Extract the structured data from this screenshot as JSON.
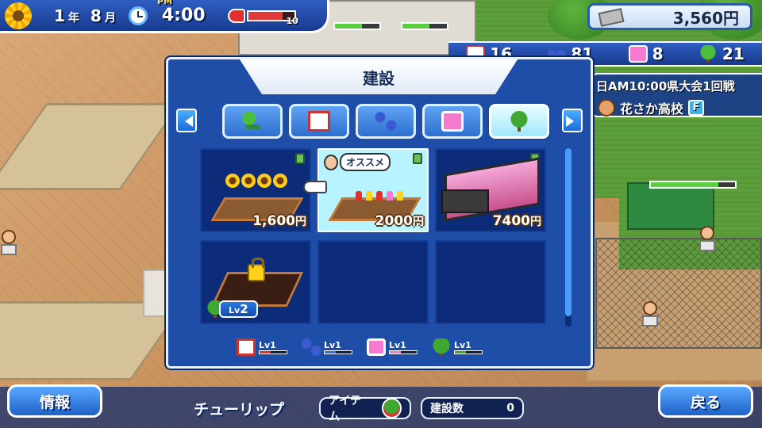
{
  "hud": {
    "year": "1",
    "year_unit": "年",
    "month": "8",
    "month_unit": "月",
    "ampm": "PM",
    "time": "4:00",
    "stamina_value": "10",
    "stamina_level": 0.75,
    "money": "3,560円",
    "stats": [
      {
        "icon": "book-icon",
        "value": "16"
      },
      {
        "icon": "dumbbell-icon",
        "value": "81"
      },
      {
        "icon": "music-note-icon",
        "value": "8"
      },
      {
        "icon": "tree-icon",
        "value": "21"
      }
    ],
    "event": "日AM10:00県大会1回戦",
    "school": "花さか高校",
    "rank": "F"
  },
  "dialog": {
    "title": "建設",
    "tabs": [
      {
        "icon": "bench-tree-icon",
        "active": false
      },
      {
        "icon": "book-icon",
        "active": false
      },
      {
        "icon": "dumbbell-icon",
        "active": false
      },
      {
        "icon": "music-note-icon",
        "active": false
      },
      {
        "icon": "tree-icon",
        "active": true
      }
    ],
    "items": [
      {
        "name": "sunflower-bed",
        "price": "1,600",
        "currency": "円",
        "locked": false,
        "recommended": false
      },
      {
        "name": "tulip-bed",
        "price": "2000",
        "currency": "円",
        "locked": false,
        "recommended": true
      },
      {
        "name": "greenhouse",
        "price": "7400",
        "currency": "円",
        "locked": false,
        "recommended": false
      },
      {
        "name": "locked-dirt-plot",
        "price": "",
        "locked": true,
        "required_level": "2",
        "level_prefix": "Lv"
      }
    ],
    "recommend_label": "オススメ",
    "levels": [
      {
        "icon": "book-icon",
        "label": "Lv1",
        "color": "#e23030",
        "fill": 0.4
      },
      {
        "icon": "dumbbell-icon",
        "label": "Lv1",
        "color": "#3a6ae8",
        "fill": 0.4
      },
      {
        "icon": "music-note-icon",
        "label": "Lv1",
        "color": "#f57ad0",
        "fill": 0.4
      },
      {
        "icon": "tree-icon",
        "label": "Lv1",
        "color": "#3fa830",
        "fill": 0.4
      }
    ]
  },
  "bottom": {
    "info_button": "情報",
    "selected_name": "チューリップ",
    "item_label": "アイテム",
    "build_count_label": "建設数",
    "build_count": "0",
    "back_button": "戻る"
  }
}
